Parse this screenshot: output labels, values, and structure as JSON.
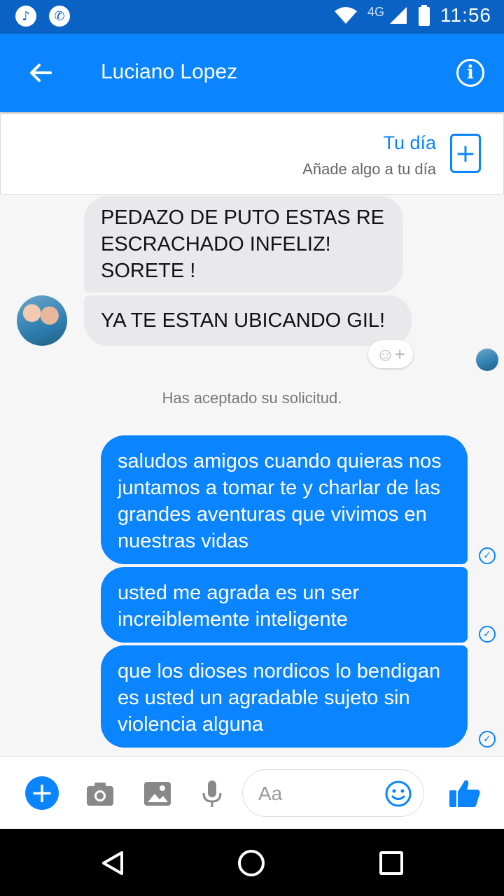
{
  "status_bar": {
    "time": "11:56",
    "network": "4G",
    "icons": [
      "music-icon",
      "whatsapp-icon",
      "wifi-icon",
      "signal-icon",
      "battery-icon"
    ]
  },
  "header": {
    "title": "Luciano Lopez",
    "icons": [
      "back-arrow-icon",
      "info-icon"
    ]
  },
  "story": {
    "title": "Tu día",
    "subtitle": "Añade algo a tu día",
    "add_icon": "plus-icon"
  },
  "messages_incoming": [
    "PEDAZO DE PUTO ESTAS RE\nESCRACHADO INFELIZ!\nSORETE !",
    "YA TE ESTAN UBICANDO GIL!"
  ],
  "system_message": "Has aceptado su solicitud.",
  "messages_outgoing": [
    "saludos amigos cuando quieras nos juntamos a tomar te y charlar de las grandes aventuras que vivimos en nuestras vidas",
    "usted me agrada es un ser increiblemente inteligente",
    "que los dioses nordicos lo bendigan es usted un agradable sujeto sin violencia alguna"
  ],
  "composer": {
    "placeholder": "Aa",
    "icons": [
      "plus-icon",
      "camera-icon",
      "image-icon",
      "microphone-icon",
      "emoji-icon",
      "thumbs-up-icon"
    ]
  },
  "nav_bar": {
    "icons": [
      "back-triangle-icon",
      "home-circle-icon",
      "recents-square-icon"
    ]
  },
  "colors": {
    "accent": "#0a84ff",
    "status_bar": "#0a62c4",
    "incoming_bubble": "#e9e9eb"
  }
}
